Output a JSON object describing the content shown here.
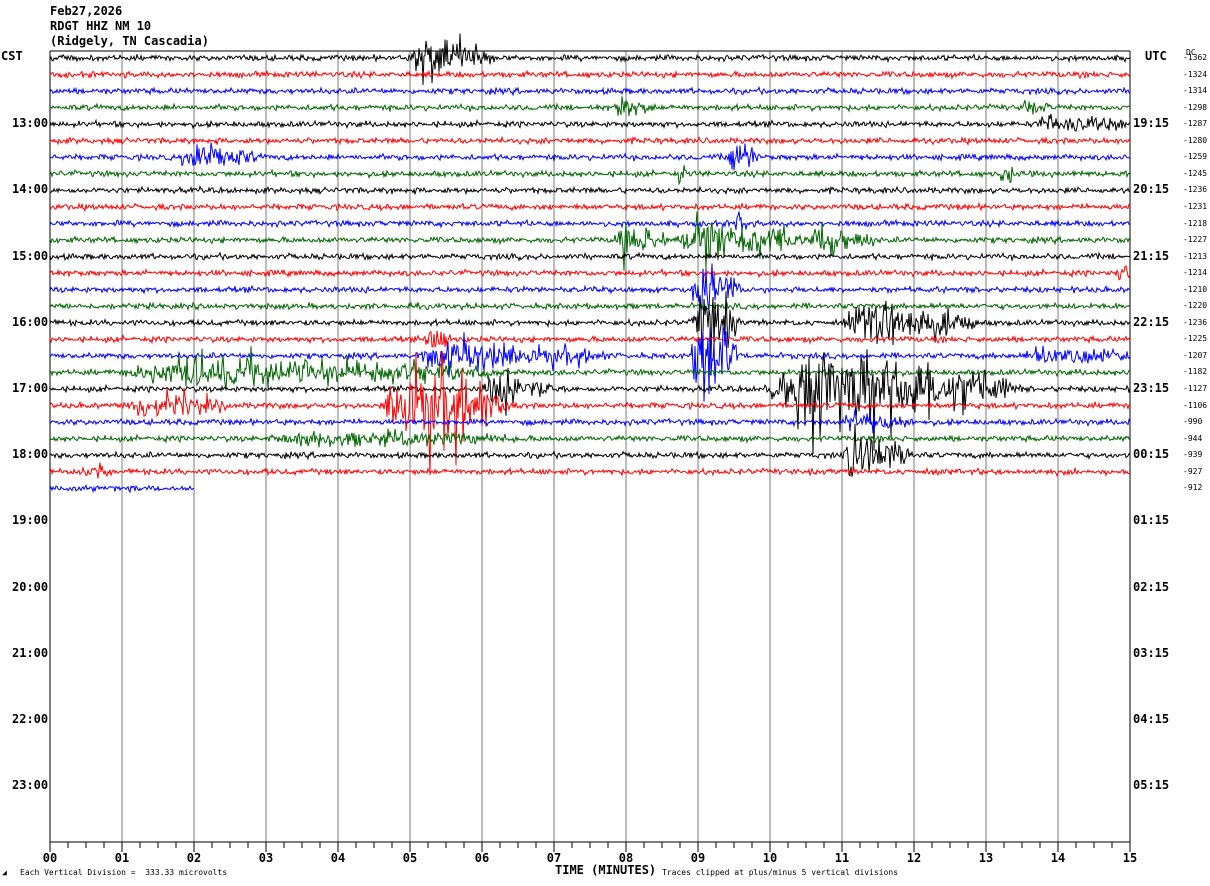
{
  "header": {
    "date": "Feb27,2026",
    "station": "RDGT HHZ NM 10",
    "location": "(Ridgely, TN Cascadia)"
  },
  "left_tz": "CST",
  "right_tz": "UTC",
  "dc_label": "DC",
  "footer": {
    "scale": "Each Vertical Division =  333.33 microvolts",
    "xlabel": "TIME (MINUTES)",
    "clip_note": "Traces clipped at plus/minus 5 vertical divisions"
  },
  "colors": {
    "black": "#000000",
    "red": "#ff0000",
    "blue": "#0000ff",
    "green": "#006600",
    "grid": "#7a7a7a"
  },
  "chart_data": {
    "type": "line",
    "title": "",
    "xlabel": "TIME (MINUTES)",
    "x_ticks": [
      "00",
      "01",
      "02",
      "03",
      "04",
      "05",
      "06",
      "07",
      "08",
      "09",
      "10",
      "11",
      "12",
      "13",
      "14",
      "15"
    ],
    "x_range": [
      0,
      15
    ],
    "trace_minutes": 15,
    "traces_per_hour": 4,
    "color_cycle": [
      "black",
      "red",
      "blue",
      "green"
    ],
    "left_hour_labels": [
      "13:00",
      "14:00",
      "15:00",
      "16:00",
      "17:00",
      "18:00",
      "19:00",
      "20:00",
      "21:00",
      "22:00",
      "23:00"
    ],
    "right_hour_labels": [
      "19:15",
      "20:15",
      "21:15",
      "22:15",
      "23:15",
      "00:15",
      "01:15",
      "02:15",
      "03:15",
      "04:15",
      "05:15"
    ],
    "dc_offsets": [
      "-1362",
      "-1324",
      "-1314",
      "-1298",
      "-1287",
      "-1280",
      "-1259",
      "-1245",
      "-1236",
      "-1231",
      "-1218",
      "-1227",
      "-1213",
      "-1214",
      "-1210",
      "-1220",
      "-1236",
      "-1225",
      "-1207",
      "-1182",
      "-1127",
      "-1106",
      "-990",
      "-944",
      "-939",
      "-927",
      "-912"
    ],
    "trace_count": 27,
    "last_trace_end_minute": 2.0,
    "events": [
      {
        "trace": 0,
        "start_min": 5.0,
        "end_min": 6.2,
        "amp": 2.6,
        "color": "black"
      },
      {
        "trace": 3,
        "start_min": 7.8,
        "end_min": 8.4,
        "amp": 0.8,
        "color": "green"
      },
      {
        "trace": 3,
        "start_min": 13.5,
        "end_min": 13.9,
        "amp": 0.6,
        "color": "green"
      },
      {
        "trace": 4,
        "start_min": 13.7,
        "end_min": 15.0,
        "amp": 1.0,
        "color": "black"
      },
      {
        "trace": 6,
        "start_min": 1.8,
        "end_min": 2.9,
        "amp": 1.8,
        "color": "blue"
      },
      {
        "trace": 6,
        "start_min": 9.4,
        "end_min": 9.9,
        "amp": 1.3,
        "color": "blue"
      },
      {
        "trace": 7,
        "start_min": 8.7,
        "end_min": 8.9,
        "amp": 1.2,
        "color": "green"
      },
      {
        "trace": 7,
        "start_min": 13.2,
        "end_min": 13.4,
        "amp": 1.4,
        "color": "green"
      },
      {
        "trace": 10,
        "start_min": 9.5,
        "end_min": 9.7,
        "amp": 1.5,
        "color": "blue"
      },
      {
        "trace": 11,
        "start_min": 7.8,
        "end_min": 8.6,
        "amp": 1.8,
        "color": "green"
      },
      {
        "trace": 11,
        "start_min": 8.7,
        "end_min": 10.5,
        "amp": 2.8,
        "color": "green"
      },
      {
        "trace": 11,
        "start_min": 10.5,
        "end_min": 11.5,
        "amp": 1.6,
        "color": "green"
      },
      {
        "trace": 13,
        "start_min": 14.8,
        "end_min": 15.0,
        "amp": 1.2,
        "color": "red"
      },
      {
        "trace": 14,
        "start_min": 8.9,
        "end_min": 9.6,
        "amp": 3.0,
        "color": "blue"
      },
      {
        "trace": 16,
        "start_min": 8.9,
        "end_min": 9.6,
        "amp": 4.0,
        "color": "blue"
      },
      {
        "trace": 16,
        "start_min": 11.0,
        "end_min": 12.9,
        "amp": 2.4,
        "color": "black"
      },
      {
        "trace": 17,
        "start_min": 5.2,
        "end_min": 5.6,
        "amp": 1.6,
        "color": "red"
      },
      {
        "trace": 18,
        "start_min": 5.0,
        "end_min": 7.8,
        "amp": 1.4,
        "color": "blue"
      },
      {
        "trace": 18,
        "start_min": 8.9,
        "end_min": 9.6,
        "amp": 5.0,
        "color": "blue"
      },
      {
        "trace": 18,
        "start_min": 13.5,
        "end_min": 15.0,
        "amp": 1.2,
        "color": "blue"
      },
      {
        "trace": 19,
        "start_min": 1.0,
        "end_min": 6.5,
        "amp": 1.6,
        "color": "green"
      },
      {
        "trace": 20,
        "start_min": 6.0,
        "end_min": 7.0,
        "amp": 2.2,
        "color": "black"
      },
      {
        "trace": 20,
        "start_min": 9.9,
        "end_min": 13.5,
        "amp": 4.6,
        "color": "black"
      },
      {
        "trace": 21,
        "start_min": 1.0,
        "end_min": 2.5,
        "amp": 1.2,
        "color": "red"
      },
      {
        "trace": 21,
        "start_min": 4.6,
        "end_min": 6.4,
        "amp": 5.0,
        "color": "red"
      },
      {
        "trace": 22,
        "start_min": 11.0,
        "end_min": 12.0,
        "amp": 1.0,
        "color": "blue"
      },
      {
        "trace": 23,
        "start_min": 3.0,
        "end_min": 6.6,
        "amp": 0.7,
        "color": "green"
      },
      {
        "trace": 24,
        "start_min": 11.0,
        "end_min": 12.0,
        "amp": 2.6,
        "color": "black"
      },
      {
        "trace": 25,
        "start_min": 0.4,
        "end_min": 0.9,
        "amp": 0.8,
        "color": "red"
      }
    ]
  }
}
